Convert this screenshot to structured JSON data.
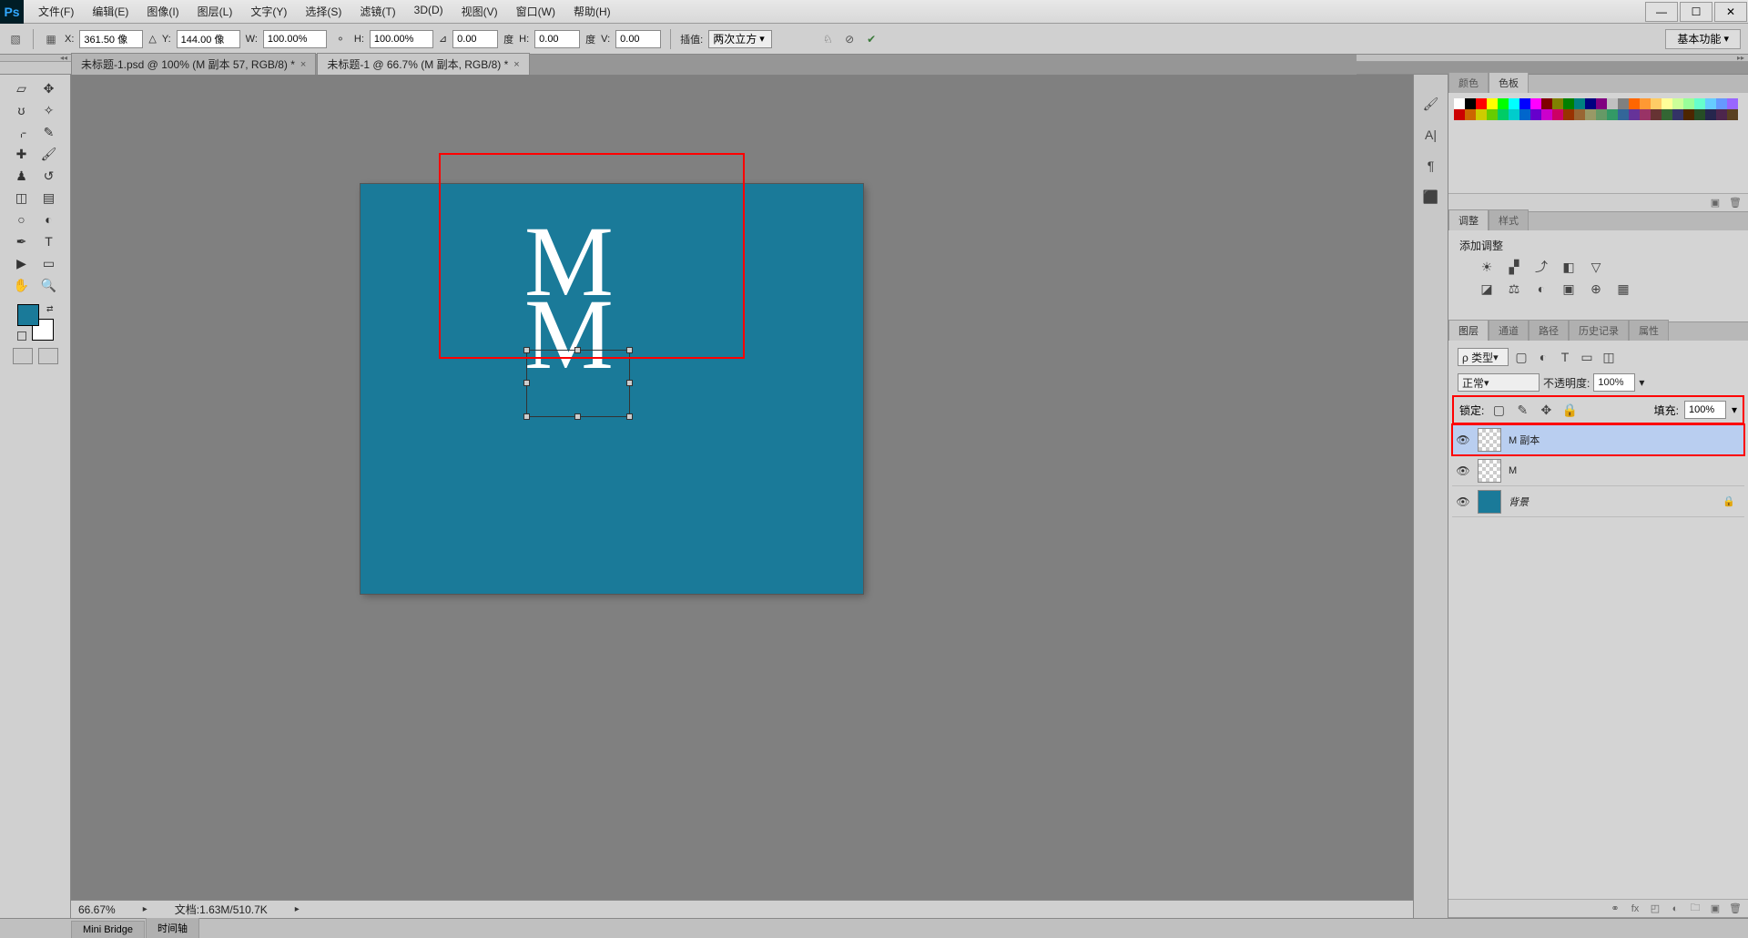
{
  "app": {
    "logo": "Ps"
  },
  "menu": [
    "文件(F)",
    "编辑(E)",
    "图像(I)",
    "图层(L)",
    "文字(Y)",
    "选择(S)",
    "滤镜(T)",
    "3D(D)",
    "视图(V)",
    "窗口(W)",
    "帮助(H)"
  ],
  "window_controls": {
    "min": "—",
    "max": "☐",
    "close": "✕"
  },
  "options": {
    "x_label": "X:",
    "x": "361.50 像",
    "y_label": "Y:",
    "y": "144.00 像",
    "w_label": "W:",
    "w": "100.00%",
    "h_label": "H:",
    "h": "100.00%",
    "angle_label": "⊿",
    "angle": "0.00",
    "angle_unit": "度",
    "hskew_label": "H:",
    "hskew": "0.00",
    "hskew_unit": "度",
    "vskew_label": "V:",
    "vskew": "0.00",
    "interp_label": "插值:",
    "interp": "两次立方",
    "workspace": "基本功能"
  },
  "tabs": [
    {
      "title": "未标题-1.psd @ 100% (M 副本 57, RGB/8) *",
      "active": false
    },
    {
      "title": "未标题-1 @ 66.7% (M 副本, RGB/8) *",
      "active": true
    }
  ],
  "canvas": {
    "zoom": "66.67%",
    "doc_status": "文档:1.63M/510.7K",
    "letter": "M",
    "bg_color": "#1a7a99"
  },
  "panels": {
    "color_tabs": [
      "颜色",
      "色板"
    ],
    "adjust_tabs": [
      "调整",
      "样式"
    ],
    "adjust_title": "添加调整",
    "layer_tabs": [
      "图层",
      "通道",
      "路径",
      "历史记录",
      "属性"
    ],
    "layer_kind": "ρ 类型",
    "blend_mode": "正常",
    "opacity_label": "不透明度:",
    "opacity": "100%",
    "lock_label": "锁定:",
    "fill_label": "填充:",
    "fill": "100%",
    "layers": [
      {
        "name": "M 副本",
        "selected": true,
        "thumb": "checker"
      },
      {
        "name": "M",
        "selected": false,
        "thumb": "checker"
      },
      {
        "name": "背景",
        "selected": false,
        "thumb": "solid",
        "locked": true
      }
    ]
  },
  "bottom_tabs": [
    "Mini Bridge",
    "时间轴"
  ],
  "swatches_colors": [
    "#ffffff",
    "#000000",
    "#ff0000",
    "#ffff00",
    "#00ff00",
    "#00ffff",
    "#0000ff",
    "#ff00ff",
    "#800000",
    "#808000",
    "#008000",
    "#008080",
    "#000080",
    "#800080",
    "#c0c0c0",
    "#808080",
    "#ff6600",
    "#ff9933",
    "#ffcc66",
    "#ffff99",
    "#ccff99",
    "#99ff99",
    "#66ffcc",
    "#66ccff",
    "#6699ff",
    "#9966ff",
    "#cc0000",
    "#cc6600",
    "#cccc00",
    "#66cc00",
    "#00cc66",
    "#00cccc",
    "#0066cc",
    "#6600cc",
    "#cc00cc",
    "#cc0066",
    "#993300",
    "#996633",
    "#999966",
    "#669966",
    "#339966",
    "#336699",
    "#663399",
    "#993366",
    "#663333",
    "#336633",
    "#333366",
    "#4d2600",
    "#264d26",
    "#26264d",
    "#4d264d",
    "#594021"
  ]
}
